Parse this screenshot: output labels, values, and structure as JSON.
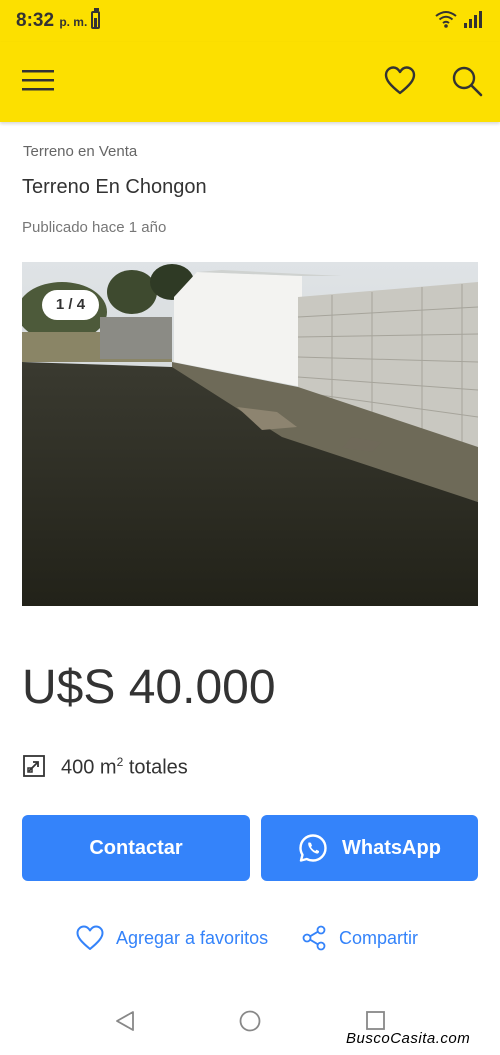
{
  "status": {
    "time": "8:32",
    "ampm": "p. m."
  },
  "colors": {
    "brand_yellow": "#fce000",
    "accent_blue": "#3483fa",
    "text_dark": "#333333"
  },
  "app_bar": {
    "icons": [
      "menu-icon",
      "heart-icon",
      "search-icon"
    ]
  },
  "listing": {
    "category": "Terreno en Venta",
    "title": "Terreno En Chongon",
    "published": "Publicado hace 1 año",
    "photo_counter": "1 / 4",
    "price": "U$S 40.000",
    "area_value": "400 m",
    "area_sup": "2",
    "area_suffix": " totales"
  },
  "actions": {
    "contact_label": "Contactar",
    "whatsapp_label": "WhatsApp",
    "favorite_label": "Agregar a favoritos",
    "share_label": "Compartir"
  },
  "watermark": "BuscoCasita.com"
}
